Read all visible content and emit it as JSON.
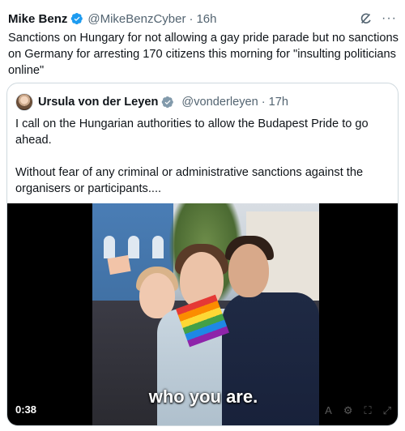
{
  "tweet": {
    "author_name": "Mike Benz",
    "author_handle": "@MikeBenzCyber",
    "time": "16h",
    "separator": "·",
    "text": "Sanctions on Hungary for not allowing a gay pride parade but no sanctions on Germany for arresting 170 citizens this morning for \"insulting politicians online\"",
    "icons": {
      "verified": "verified-badge-icon",
      "grok": "grok-icon",
      "more": "more-icon"
    },
    "more_glyph": "···"
  },
  "quote": {
    "author_name": "Ursula von der Leyen",
    "author_handle": "@vonderleyen",
    "time": "17h",
    "separator": "·",
    "paragraph1": "I call on the Hungarian authorities to allow the Budapest Pride to go ahead.",
    "paragraph2": "Without fear of any criminal or administrative sanctions against the organisers or participants....",
    "icons": {
      "avatar": "avatar",
      "verified": "verified-badge-gray-icon"
    }
  },
  "video": {
    "caption": "who you are.",
    "timestamp": "0:38",
    "controls": [
      "A",
      "⚙",
      "⛶",
      "⤢"
    ]
  },
  "colors": {
    "text": "#0f1419",
    "secondary": "#536471",
    "verified_blue": "#1d9bf0",
    "verified_gray": "#829aab",
    "border": "#cfd9de"
  }
}
